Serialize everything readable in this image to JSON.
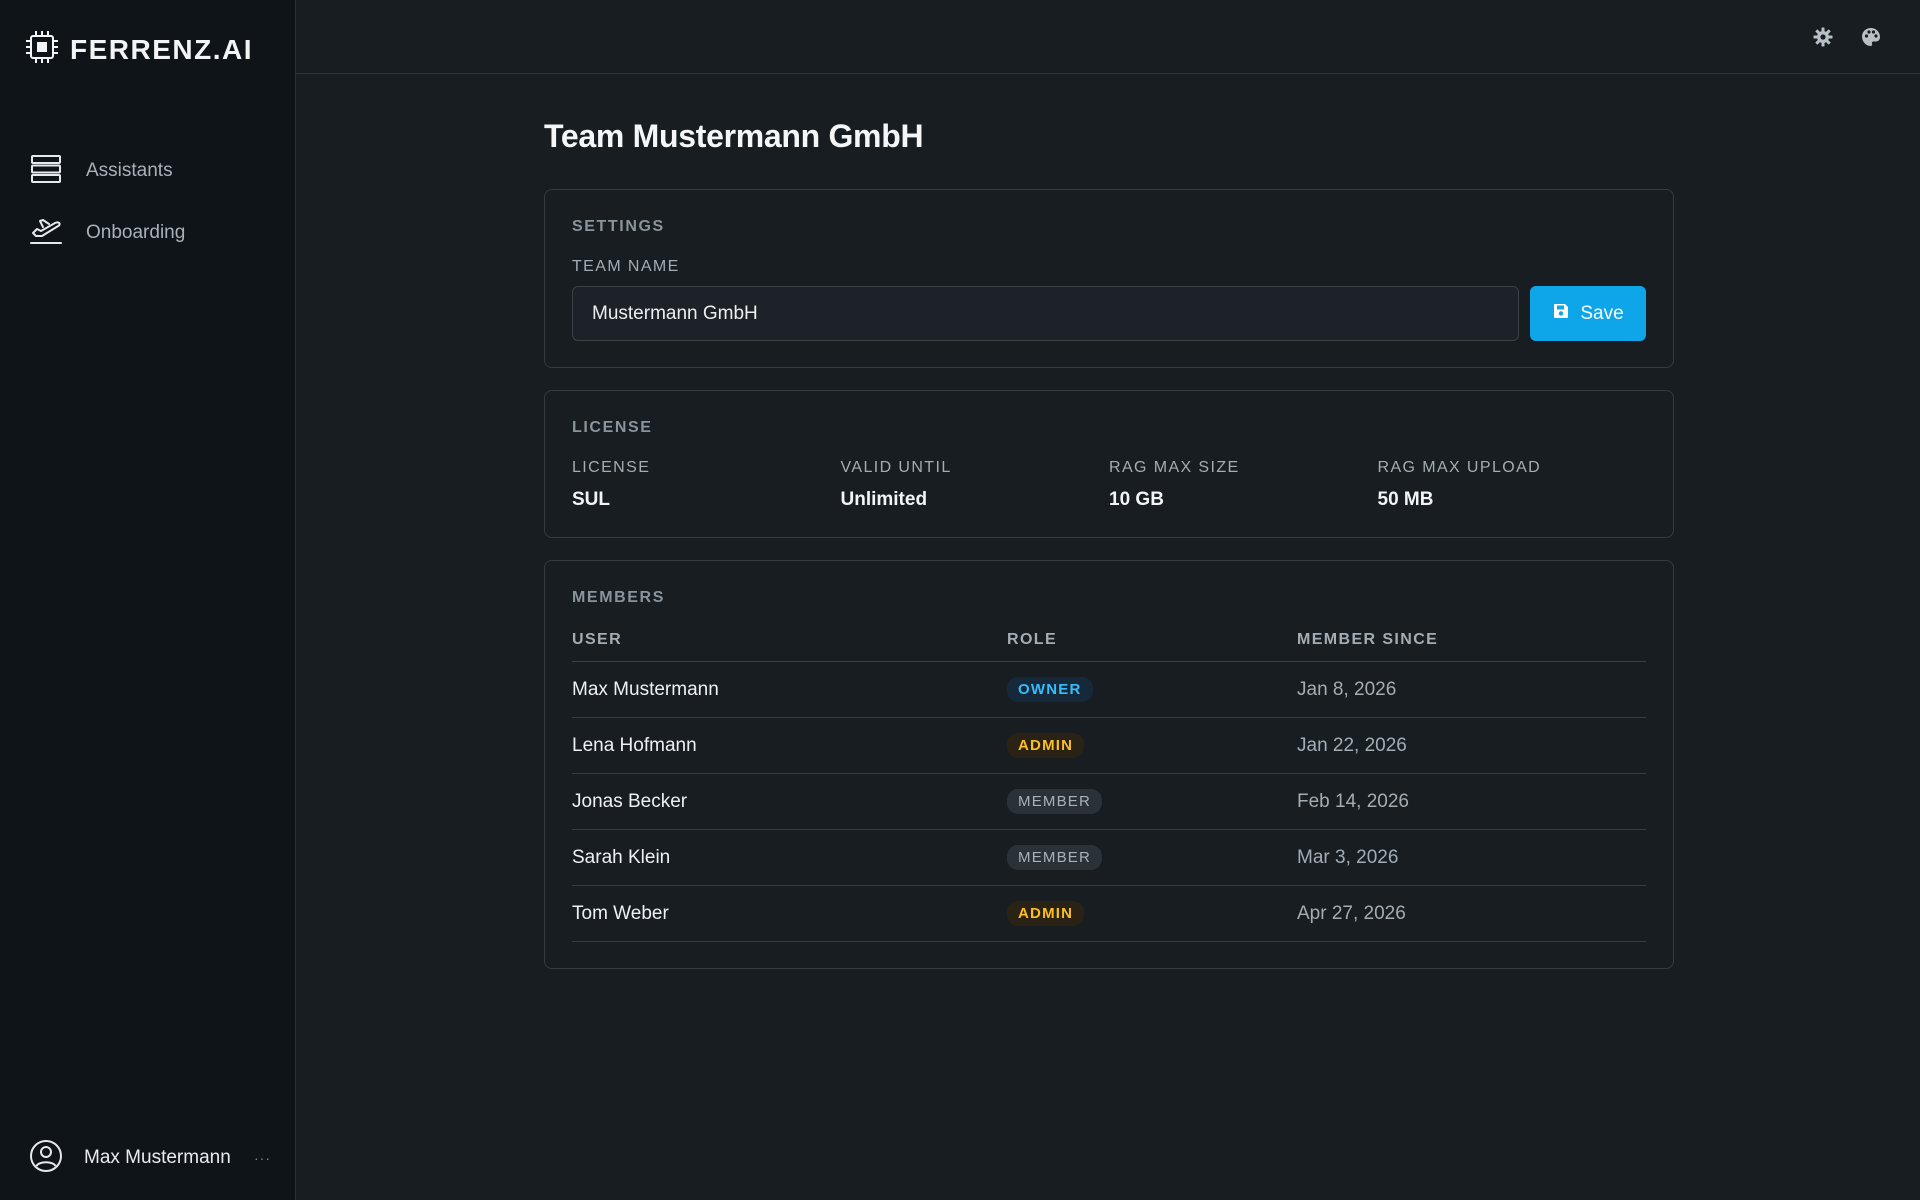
{
  "app": {
    "logo_text": "FERRENZ.AI"
  },
  "sidebar": {
    "items": [
      {
        "label": "Assistants",
        "icon": "server-stack-icon"
      },
      {
        "label": "Onboarding",
        "icon": "plane-takeoff-icon"
      }
    ],
    "user": {
      "name": "Max Mustermann",
      "more": "···",
      "icon": "user-circle-icon"
    }
  },
  "topbar": {
    "icons": [
      "gear-icon",
      "palette-icon"
    ]
  },
  "page": {
    "title": "Team Mustermann GmbH"
  },
  "settings": {
    "section_title": "SETTINGS",
    "team_name_label": "TEAM NAME",
    "team_name_value": "Mustermann GmbH",
    "save_label": "Save"
  },
  "license": {
    "section_title": "LICENSE",
    "fields": [
      {
        "label": "LICENSE",
        "value": "SUL"
      },
      {
        "label": "VALID UNTIL",
        "value": "Unlimited"
      },
      {
        "label": "RAG MAX SIZE",
        "value": "10 GB"
      },
      {
        "label": "RAG MAX UPLOAD",
        "value": "50 MB"
      }
    ]
  },
  "members": {
    "section_title": "MEMBERS",
    "columns": [
      "USER",
      "ROLE",
      "MEMBER SINCE"
    ],
    "rows": [
      {
        "user": "Max Mustermann",
        "role": "OWNER",
        "role_type": "owner",
        "since": "Jan 8, 2026"
      },
      {
        "user": "Lena Hofmann",
        "role": "ADMIN",
        "role_type": "admin",
        "since": "Jan 22, 2026"
      },
      {
        "user": "Jonas Becker",
        "role": "MEMBER",
        "role_type": "member",
        "since": "Feb 14, 2026"
      },
      {
        "user": "Sarah Klein",
        "role": "MEMBER",
        "role_type": "member",
        "since": "Mar 3, 2026"
      },
      {
        "user": "Tom Weber",
        "role": "ADMIN",
        "role_type": "admin",
        "since": "Apr 27, 2026"
      }
    ]
  },
  "colors": {
    "accent": "#0ea5e9",
    "owner": "#38bdf8",
    "admin": "#fbbf24",
    "member": "#a9b1b8",
    "sidebar_bg": "#0f1418",
    "main_bg": "#171d21"
  }
}
